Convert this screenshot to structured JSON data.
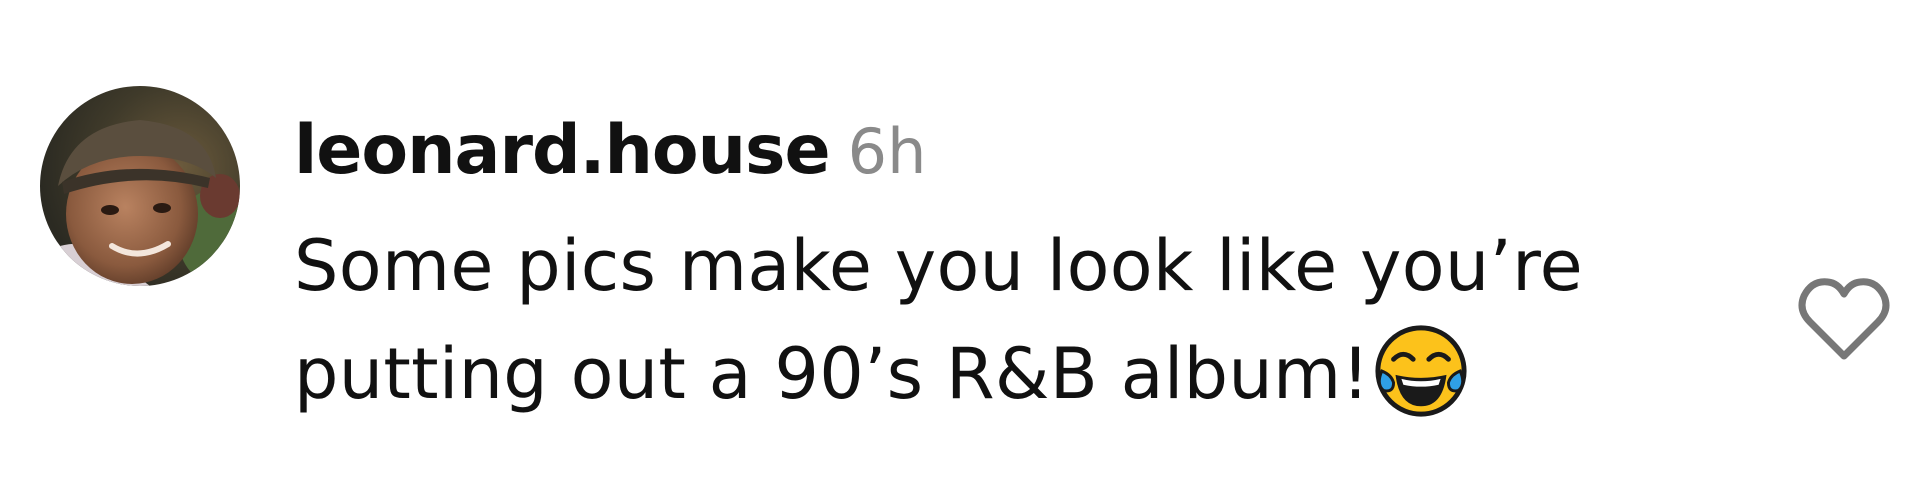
{
  "comment": {
    "username": "leonard.house",
    "timestamp": "6h",
    "text_line1": "Some pics make you look like you’re",
    "text_line2": "putting out a 90’s R&B album!",
    "emoji": "face-with-tears-of-joy"
  },
  "icons": {
    "avatar": "user-avatar-photo",
    "like": "heart-outline-icon"
  },
  "colors": {
    "background": "#ffffff",
    "text": "#111111",
    "timestamp": "#8a8a8a",
    "like_icon": "#777777"
  }
}
